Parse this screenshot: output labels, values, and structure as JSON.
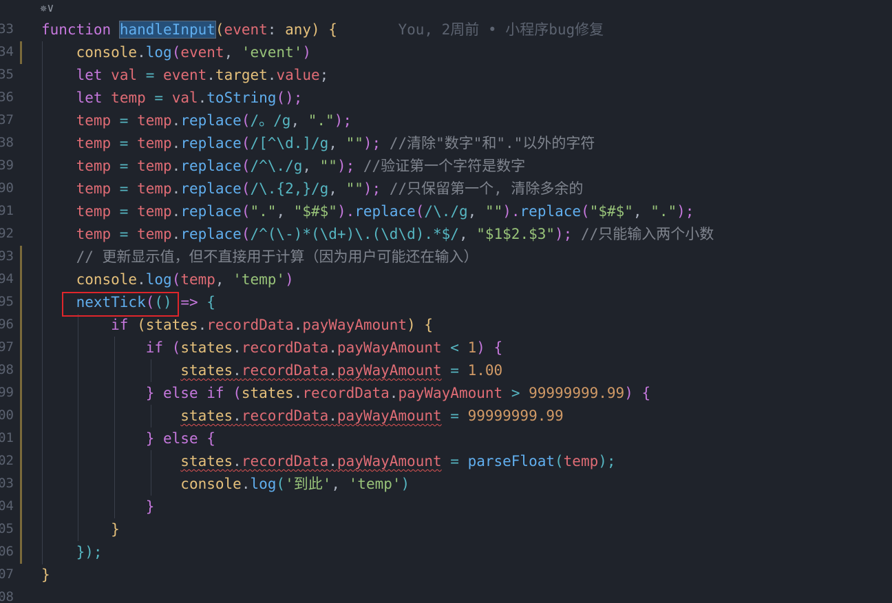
{
  "top_bar": {
    "icon": "vue-logo-icon",
    "chevron": "chevron-down-icon"
  },
  "blame": {
    "text": "You, 2周前 • 小程序bug修复"
  },
  "lines": [
    {
      "num": "33"
    },
    {
      "num": "34"
    },
    {
      "num": "35"
    },
    {
      "num": "36"
    },
    {
      "num": "37"
    },
    {
      "num": "38"
    },
    {
      "num": "39"
    },
    {
      "num": "90"
    },
    {
      "num": "91"
    },
    {
      "num": "92"
    },
    {
      "num": "93"
    },
    {
      "num": "94"
    },
    {
      "num": "95"
    },
    {
      "num": "96"
    },
    {
      "num": "97"
    },
    {
      "num": "98"
    },
    {
      "num": "99"
    },
    {
      "num": "00"
    },
    {
      "num": "01"
    },
    {
      "num": "02"
    },
    {
      "num": "03"
    },
    {
      "num": "04"
    },
    {
      "num": "05"
    },
    {
      "num": "06"
    },
    {
      "num": "07"
    },
    {
      "num": "08"
    }
  ],
  "code": {
    "l1": {
      "kw": "function",
      "name": "handleInput",
      "sig_a": "(",
      "param": "event",
      "sig_b": ": ",
      "type": "any",
      "sig_c": ") {"
    },
    "l2": {
      "obj": "console",
      "dot": ".",
      "fn": "log",
      "a": "(",
      "arg": "event",
      "sep": ", ",
      "str": "'event'",
      "b": ")"
    },
    "l3": {
      "kw": "let",
      "var": "val",
      "eq": " = ",
      "obj": "event",
      "d1": ".",
      "p1": "target",
      "d2": ".",
      "p2": "value",
      "end": ";"
    },
    "l4": {
      "kw": "let",
      "var": "temp",
      "eq": " = ",
      "obj": "val",
      "dot": ".",
      "fn": "toString",
      "end": "();"
    },
    "l5": {
      "var": "temp",
      "eq": " = ",
      "obj": "temp",
      "dot": ".",
      "fn": "replace",
      "a": "(",
      "re": "/。/g",
      "sep": ", ",
      "str": "\".\"",
      "end": ");"
    },
    "l6": {
      "var": "temp",
      "eq": " = ",
      "obj": "temp",
      "dot": ".",
      "fn": "replace",
      "a": "(",
      "re": "/[^\\d.]/g",
      "sep": ", ",
      "str": "\"\"",
      "end": "); ",
      "comment": "//清除\"数字\"和\".\"以外的字符"
    },
    "l7": {
      "var": "temp",
      "eq": " = ",
      "obj": "temp",
      "dot": ".",
      "fn": "replace",
      "a": "(",
      "re": "/^\\./g",
      "sep": ", ",
      "str": "\"\"",
      "end": "); ",
      "comment": "//验证第一个字符是数字"
    },
    "l8": {
      "var": "temp",
      "eq": " = ",
      "obj": "temp",
      "dot": ".",
      "fn": "replace",
      "a": "(",
      "re": "/\\.{2,}/g",
      "sep": ", ",
      "str": "\"\"",
      "end": "); ",
      "comment": "//只保留第一个, 清除多余的"
    },
    "l9": {
      "var": "temp",
      "eq": " = ",
      "obj": "temp",
      "dot": ".",
      "fn": "replace",
      "a": "(",
      "str1": "\".\"",
      "sep": ", ",
      "str2": "\"$#$\"",
      "mid1": ").",
      "fn2": "replace",
      "a2": "(",
      "re": "/\\./g",
      "sep2": ", ",
      "str3": "\"\"",
      "mid2": ").",
      "fn3": "replace",
      "a3": "(",
      "str4": "\"$#$\"",
      "sep3": ", ",
      "str5": "\".\"",
      "end": ");"
    },
    "l10": {
      "var": "temp",
      "eq": " = ",
      "obj": "temp",
      "dot": ".",
      "fn": "replace",
      "a": "(",
      "re": "/^(\\-)*(\\d+)\\.(\\d\\d).*$/",
      "sep": ", ",
      "str": "\"$1$2.$3\"",
      "end": "); ",
      "comment": "//只能输入两个小数"
    },
    "l11": {
      "comment": "// 更新显示值，但不直接用于计算（因为用户可能还在输入）"
    },
    "l12": {
      "obj": "console",
      "dot": ".",
      "fn": "log",
      "a": "(",
      "arg": "temp",
      "sep": ", ",
      "str": "'temp'",
      "b": ")"
    },
    "l13": {
      "fn": "nextTick",
      "a": "(",
      "b": "()",
      "arrow": " => ",
      "c": "{"
    },
    "l14": {
      "kw": "if",
      "a": " (",
      "obj": "states",
      "d1": ".",
      "p1": "recordData",
      "d2": ".",
      "p2": "payWayAmount",
      "b": ") {"
    },
    "l15": {
      "kw": "if",
      "a": " (",
      "obj": "states",
      "d1": ".",
      "p1": "recordData",
      "d2": ".",
      "p2": "payWayAmount",
      "op": " < ",
      "num": "1",
      "b": ") {"
    },
    "l16": {
      "obj": "states",
      "d1": ".",
      "p1": "recordData",
      "d2": ".",
      "p2": "payWayAmount",
      "eq": " = ",
      "num": "1.00"
    },
    "l17": {
      "a": "} ",
      "kw1": "else",
      "sp": " ",
      "kw2": "if",
      "b": " (",
      "obj": "states",
      "d1": ".",
      "p1": "recordData",
      "d2": ".",
      "p2": "payWayAmount",
      "op": " > ",
      "num": "99999999.99",
      "c": ") {"
    },
    "l18": {
      "obj": "states",
      "d1": ".",
      "p1": "recordData",
      "d2": ".",
      "p2": "payWayAmount",
      "eq": " = ",
      "num": "99999999.99"
    },
    "l19": {
      "a": "} ",
      "kw": "else",
      "b": " {"
    },
    "l20": {
      "obj": "states",
      "d1": ".",
      "p1": "recordData",
      "d2": ".",
      "p2": "payWayAmount",
      "eq": " = ",
      "fn": "parseFloat",
      "a": "(",
      "arg": "temp",
      "end": ");"
    },
    "l21": {
      "obj": "console",
      "dot": ".",
      "fn": "log",
      "a": "(",
      "str1": "'到此'",
      "sep": ", ",
      "str2": "'temp'",
      "b": ")"
    },
    "l22": {
      "c": "}"
    },
    "l23": {
      "c": "}"
    },
    "l24": {
      "c": "});"
    },
    "l25": {
      "c": "}"
    }
  }
}
